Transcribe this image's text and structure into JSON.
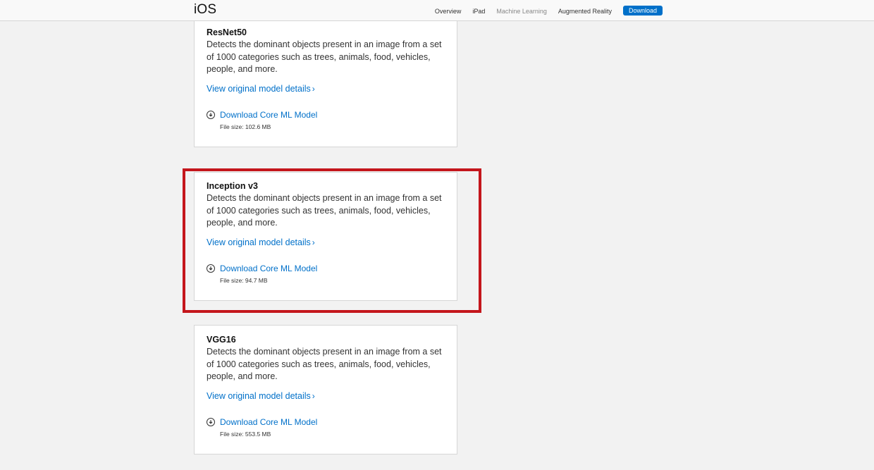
{
  "nav": {
    "title": "iOS",
    "links": [
      "Overview",
      "iPad",
      "Machine Learning",
      "Augmented Reality"
    ],
    "download_label": "Download"
  },
  "models": [
    {
      "name": "ResNet50",
      "description": "Detects the dominant objects present in an image from a set of 1000 categories such as trees, animals, food, vehicles, people, and more.",
      "details_link": "View original model details",
      "download_label": "Download Core ML Model",
      "file_size": "File size: 102.6 MB"
    },
    {
      "name": "Inception v3",
      "description": "Detects the dominant objects present in an image from a set of 1000 categories such as trees, animals, food, vehicles, people, and more.",
      "details_link": "View original model details",
      "download_label": "Download Core ML Model",
      "file_size": "File size: 94.7 MB"
    },
    {
      "name": "VGG16",
      "description": "Detects the dominant objects present in an image from a set of 1000 categories such as trees, animals, food, vehicles, people, and more.",
      "details_link": "View original model details",
      "download_label": "Download Core ML Model",
      "file_size": "File size: 553.5 MB"
    }
  ],
  "colors": {
    "accent": "#0070c9",
    "highlight": "#c4161c",
    "background": "#f2f2f2"
  },
  "icons": {
    "download": "download-circle-icon",
    "chevron": "chevron-right-icon"
  }
}
